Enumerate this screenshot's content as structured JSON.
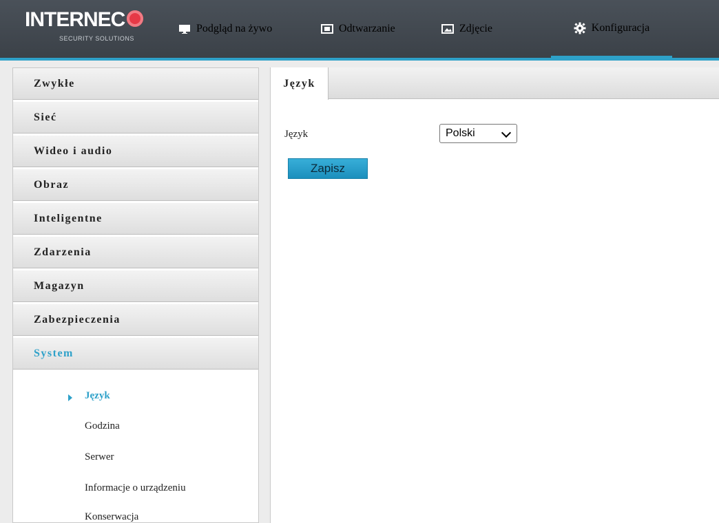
{
  "brand": {
    "name_part1": "INTER",
    "name_part2": "NEC",
    "tagline": "SECURITY SOLUTIONS"
  },
  "nav": [
    {
      "label": "Podgląd na żywo",
      "icon": "monitor-icon"
    },
    {
      "label": "Odtwarzanie",
      "icon": "film-icon"
    },
    {
      "label": "Zdjęcie",
      "icon": "image-icon"
    },
    {
      "label": "Konfiguracja",
      "icon": "gear-icon",
      "active": true
    }
  ],
  "sidebar": {
    "items": [
      {
        "label": "Zwykłe"
      },
      {
        "label": "Sieć"
      },
      {
        "label": "Wideo i audio"
      },
      {
        "label": "Obraz"
      },
      {
        "label": "Inteligentne"
      },
      {
        "label": "Zdarzenia"
      },
      {
        "label": "Magazyn"
      },
      {
        "label": "Zabezpieczenia"
      },
      {
        "label": "System",
        "active": true
      }
    ],
    "submenu": [
      {
        "label": "Język",
        "active": true
      },
      {
        "label": "Godzina"
      },
      {
        "label": "Serwer"
      },
      {
        "label": "Informacje o urządzeniu"
      },
      {
        "label": "Konserwacja"
      }
    ]
  },
  "main": {
    "tab": "Język",
    "field_label": "Język",
    "select_value": "Polski",
    "save_label": "Zapisz"
  },
  "colors": {
    "accent": "#2ea1c9",
    "header_bg": "#3f454c",
    "button": "#2aa3cf"
  }
}
